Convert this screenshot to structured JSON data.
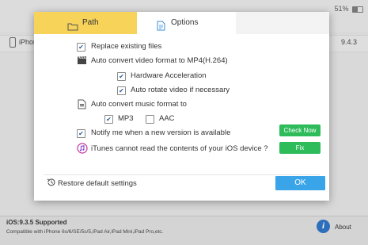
{
  "background": {
    "battery_text": "51%",
    "device_label": "iPhone",
    "device_version": "9.4.3",
    "ios_status": "iOS:9.3.5  Supported",
    "compatibility": "Compatible with iPhone 6s/6/SE/5s/5,iPad Air,iPad Mini,iPad Pro,etc.",
    "about_label": "About",
    "about_icon": "info-icon"
  },
  "dialog": {
    "tabs": [
      {
        "label": "Path",
        "icon": "folder-icon",
        "color": "#f7d35a"
      },
      {
        "label": "Options",
        "icon": "document-icon",
        "color": "#ffffff"
      }
    ],
    "options": {
      "replace_existing": {
        "label": "Replace existing files",
        "checked": true
      },
      "convert_video": {
        "label": "Auto convert video format to MP4(H.264)",
        "icon": "video-clapper-icon"
      },
      "hardware_accel": {
        "label": "Hardware Acceleration",
        "checked": true
      },
      "auto_rotate": {
        "label": "Auto rotate video if necessary",
        "checked": true
      },
      "convert_music": {
        "label": "Auto convert music format to",
        "icon": "music-file-icon"
      },
      "mp3": {
        "label": "MP3",
        "checked": true
      },
      "aac": {
        "label": "AAC",
        "checked": false
      },
      "notify": {
        "label": "Notify me when a new version is available",
        "checked": true
      },
      "check_now": "Check Now",
      "itunes_warning": "iTunes cannot read the contents of your iOS device ?",
      "itunes_icon": "itunes-icon",
      "fix": "Fix"
    },
    "restore_label": "Restore default settings",
    "restore_icon": "restore-icon",
    "ok_label": "OK",
    "accent_green": "#2ebc5b",
    "accent_blue": "#3aa4e8"
  }
}
